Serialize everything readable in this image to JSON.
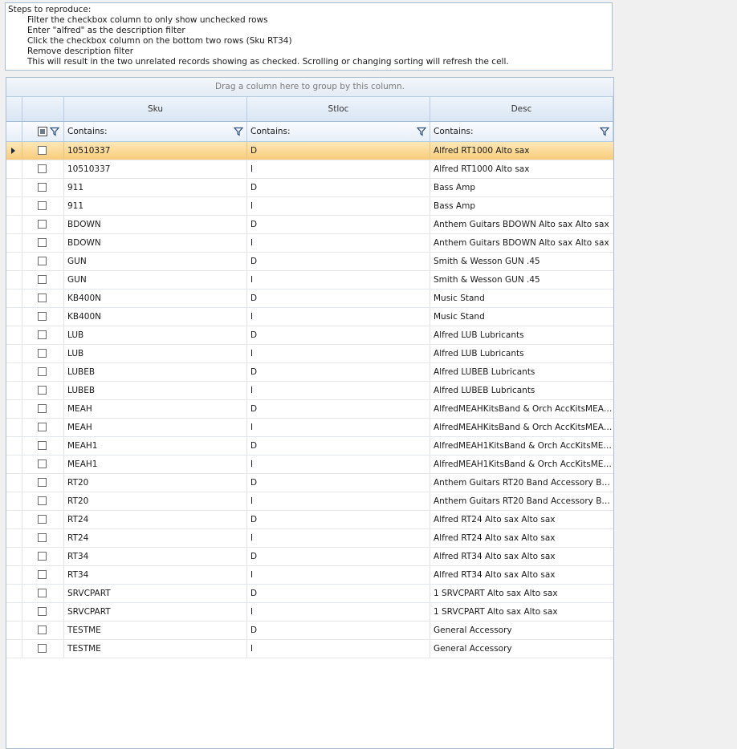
{
  "notes": {
    "heading": "Steps to reproduce:",
    "steps": [
      "Filter the checkbox column to only show unchecked rows",
      "Enter \"alfred\" as the description filter",
      "Click the checkbox column on the bottom two rows (Sku RT34)",
      "Remove description filter",
      "This will result in the two unrelated records showing as checked. Scrolling or changing sorting will refresh the cell."
    ]
  },
  "grid": {
    "group_panel_text": "Drag a column here to group by this column.",
    "columns": {
      "sku": "Sku",
      "stloc": "Stloc",
      "desc": "Desc"
    },
    "filter": {
      "sku": "Contains:",
      "stloc": "Contains:",
      "desc": "Contains:"
    },
    "rows": [
      {
        "sku": "10510337",
        "stloc": "D",
        "desc": "Alfred RT1000 Alto sax",
        "checked": false,
        "selected": true
      },
      {
        "sku": "10510337",
        "stloc": "I",
        "desc": "Alfred RT1000 Alto sax",
        "checked": false
      },
      {
        "sku": "911",
        "stloc": "D",
        "desc": "Bass Amp",
        "checked": false
      },
      {
        "sku": "911",
        "stloc": "I",
        "desc": "Bass Amp",
        "checked": false
      },
      {
        "sku": "BDOWN",
        "stloc": "D",
        "desc": "Anthem Guitars BDOWN Alto sax Alto sax",
        "checked": false
      },
      {
        "sku": "BDOWN",
        "stloc": "I",
        "desc": "Anthem Guitars BDOWN Alto sax Alto sax",
        "checked": false
      },
      {
        "sku": "GUN",
        "stloc": "D",
        "desc": "Smith & Wesson GUN .45",
        "checked": false
      },
      {
        "sku": "GUN",
        "stloc": "I",
        "desc": "Smith & Wesson GUN .45",
        "checked": false
      },
      {
        "sku": "KB400N",
        "stloc": "D",
        "desc": "Music Stand",
        "checked": false
      },
      {
        "sku": "KB400N",
        "stloc": "I",
        "desc": "Music Stand",
        "checked": false
      },
      {
        "sku": "LUB",
        "stloc": "D",
        "desc": "Alfred LUB Lubricants",
        "checked": false
      },
      {
        "sku": "LUB",
        "stloc": "I",
        "desc": "Alfred LUB Lubricants",
        "checked": false
      },
      {
        "sku": "LUBEB",
        "stloc": "D",
        "desc": "Alfred LUBEB Lubricants",
        "checked": false
      },
      {
        "sku": "LUBEB",
        "stloc": "I",
        "desc": "Alfred LUBEB Lubricants",
        "checked": false
      },
      {
        "sku": "MEAH",
        "stloc": "D",
        "desc": "AlfredMEAHKitsBand & Orch AccKitsMEAH...",
        "checked": false
      },
      {
        "sku": "MEAH",
        "stloc": "I",
        "desc": "AlfredMEAHKitsBand & Orch AccKitsMEAH...",
        "checked": false
      },
      {
        "sku": "MEAH1",
        "stloc": "D",
        "desc": "AlfredMEAH1KitsBand & Orch AccKitsMEA...",
        "checked": false
      },
      {
        "sku": "MEAH1",
        "stloc": "I",
        "desc": "AlfredMEAH1KitsBand & Orch AccKitsMEA...",
        "checked": false
      },
      {
        "sku": "RT20",
        "stloc": "D",
        "desc": "Anthem Guitars RT20 Band Accessory Ban...",
        "checked": false
      },
      {
        "sku": "RT20",
        "stloc": "I",
        "desc": "Anthem Guitars RT20 Band Accessory Ban...",
        "checked": false
      },
      {
        "sku": "RT24",
        "stloc": "D",
        "desc": "Alfred RT24 Alto sax Alto sax",
        "checked": false
      },
      {
        "sku": "RT24",
        "stloc": "I",
        "desc": "Alfred RT24 Alto sax Alto sax",
        "checked": false
      },
      {
        "sku": "RT34",
        "stloc": "D",
        "desc": "Alfred RT34 Alto sax Alto sax",
        "checked": false
      },
      {
        "sku": "RT34",
        "stloc": "I",
        "desc": "Alfred RT34 Alto sax Alto sax",
        "checked": false
      },
      {
        "sku": "SRVCPART",
        "stloc": "D",
        "desc": "1 SRVCPART Alto sax Alto sax",
        "checked": false
      },
      {
        "sku": "SRVCPART",
        "stloc": "I",
        "desc": "1 SRVCPART Alto sax Alto sax",
        "checked": false
      },
      {
        "sku": "TESTME",
        "stloc": "D",
        "desc": "General Accessory",
        "checked": false
      },
      {
        "sku": "TESTME",
        "stloc": "I",
        "desc": "General Accessory",
        "checked": false
      }
    ]
  },
  "icons": {
    "filter": "funnel-icon",
    "row_indicator": "triangle-right-icon",
    "checkbox_filter": "checkbox-indeterminate-icon"
  }
}
